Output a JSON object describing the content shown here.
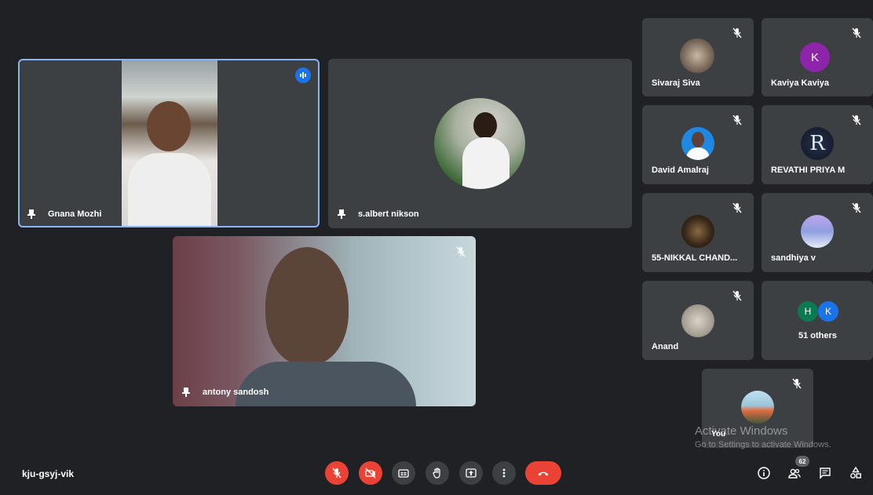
{
  "meeting": {
    "code": "kju-gsyj-vik"
  },
  "main_tiles": [
    {
      "name": "Gnana Mozhi"
    },
    {
      "name": "s.albert nikson"
    },
    {
      "name": "antony sandosh"
    }
  ],
  "side_tiles": [
    {
      "name": "Sivaraj Siva"
    },
    {
      "name": "Kaviya Kaviya",
      "initial": "K",
      "color": "#8e24aa"
    },
    {
      "name": "David Amalraj"
    },
    {
      "name": "REVATHI PRIYA M"
    },
    {
      "name": "55-NIKKAL CHAND..."
    },
    {
      "name": "sandhiya v"
    },
    {
      "name": "Anand"
    },
    {
      "name": "51 others",
      "initial_h": "H",
      "initial_k": "K"
    },
    {
      "name": "You"
    }
  ],
  "toolbar": {
    "participants_count": "62"
  },
  "watermark": {
    "title": "Activate Windows",
    "subtitle": "Go to Settings to activate Windows."
  },
  "colors": {
    "accent": "#8ab4f8",
    "danger": "#ea4335",
    "tile": "#3c4043",
    "background": "#202124"
  }
}
